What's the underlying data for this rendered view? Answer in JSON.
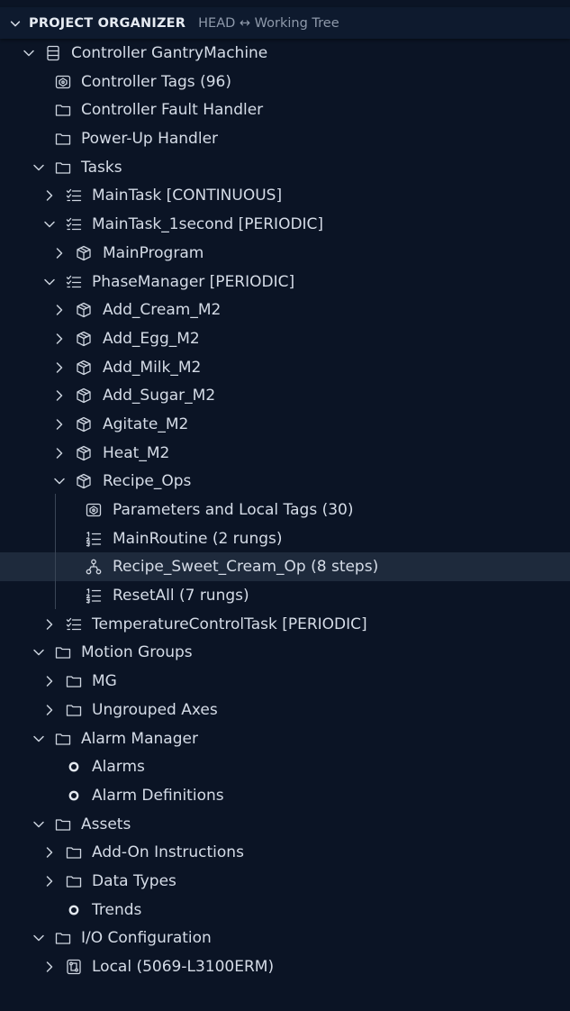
{
  "header": {
    "title": "PROJECT ORGANIZER",
    "subtitle": "HEAD ↔ Working Tree"
  },
  "tree": [
    {
      "label": "Controller GantryMachine",
      "depth": 0,
      "twistie": "expanded",
      "icon": "database-icon"
    },
    {
      "label": "Controller Tags (96)",
      "depth": 1,
      "twistie": "none",
      "icon": "symbol-tags-icon"
    },
    {
      "label": "Controller Fault Handler",
      "depth": 1,
      "twistie": "none",
      "icon": "folder-icon"
    },
    {
      "label": "Power-Up Handler",
      "depth": 1,
      "twistie": "none",
      "icon": "folder-icon"
    },
    {
      "label": "Tasks",
      "depth": 1,
      "twistie": "expanded",
      "icon": "folder-icon"
    },
    {
      "label": "MainTask [CONTINUOUS]",
      "depth": 2,
      "twistie": "collapsed",
      "icon": "tasklist-icon"
    },
    {
      "label": "MainTask_1second [PERIODIC]",
      "depth": 2,
      "twistie": "expanded",
      "icon": "tasklist-icon"
    },
    {
      "label": "MainProgram",
      "depth": 3,
      "twistie": "collapsed",
      "icon": "package-icon"
    },
    {
      "label": "PhaseManager [PERIODIC]",
      "depth": 2,
      "twistie": "expanded",
      "icon": "tasklist-icon"
    },
    {
      "label": "Add_Cream_M2",
      "depth": 3,
      "twistie": "collapsed",
      "icon": "package-icon"
    },
    {
      "label": "Add_Egg_M2",
      "depth": 3,
      "twistie": "collapsed",
      "icon": "package-icon"
    },
    {
      "label": "Add_Milk_M2",
      "depth": 3,
      "twistie": "collapsed",
      "icon": "package-icon"
    },
    {
      "label": "Add_Sugar_M2",
      "depth": 3,
      "twistie": "collapsed",
      "icon": "package-icon"
    },
    {
      "label": "Agitate_M2",
      "depth": 3,
      "twistie": "collapsed",
      "icon": "package-icon"
    },
    {
      "label": "Heat_M2",
      "depth": 3,
      "twistie": "collapsed",
      "icon": "package-icon"
    },
    {
      "label": "Recipe_Ops",
      "depth": 3,
      "twistie": "expanded",
      "icon": "package-icon"
    },
    {
      "label": "Parameters and Local Tags (30)",
      "depth": 4,
      "twistie": "none",
      "icon": "symbol-tags-icon"
    },
    {
      "label": "MainRoutine (2 rungs)",
      "depth": 4,
      "twistie": "none",
      "icon": "list-ordered-icon"
    },
    {
      "label": "Recipe_Sweet_Cream_Op (8 steps)",
      "depth": 4,
      "twistie": "none",
      "icon": "type-hierarchy-icon",
      "selected": true
    },
    {
      "label": "ResetAll (7 rungs)",
      "depth": 4,
      "twistie": "none",
      "icon": "list-ordered-icon"
    },
    {
      "label": "TemperatureControlTask [PERIODIC]",
      "depth": 2,
      "twistie": "collapsed",
      "icon": "tasklist-icon"
    },
    {
      "label": "Motion Groups",
      "depth": 1,
      "twistie": "expanded",
      "icon": "folder-icon"
    },
    {
      "label": "MG",
      "depth": 2,
      "twistie": "collapsed",
      "icon": "folder-icon"
    },
    {
      "label": "Ungrouped Axes",
      "depth": 2,
      "twistie": "collapsed",
      "icon": "folder-icon"
    },
    {
      "label": "Alarm Manager",
      "depth": 1,
      "twistie": "expanded",
      "icon": "folder-icon"
    },
    {
      "label": "Alarms",
      "depth": 2,
      "twistie": "none",
      "icon": "circle-icon"
    },
    {
      "label": "Alarm Definitions",
      "depth": 2,
      "twistie": "none",
      "icon": "circle-icon"
    },
    {
      "label": "Assets",
      "depth": 1,
      "twistie": "expanded",
      "icon": "folder-icon"
    },
    {
      "label": "Add-On Instructions",
      "depth": 2,
      "twistie": "collapsed",
      "icon": "folder-icon"
    },
    {
      "label": "Data Types",
      "depth": 2,
      "twistie": "collapsed",
      "icon": "folder-icon"
    },
    {
      "label": "Trends",
      "depth": 2,
      "twistie": "none",
      "icon": "circle-icon"
    },
    {
      "label": "I/O Configuration",
      "depth": 1,
      "twistie": "expanded",
      "icon": "folder-icon"
    },
    {
      "label": "Local (5069-L3100ERM)",
      "depth": 2,
      "twistie": "collapsed",
      "icon": "device-icon"
    }
  ]
}
